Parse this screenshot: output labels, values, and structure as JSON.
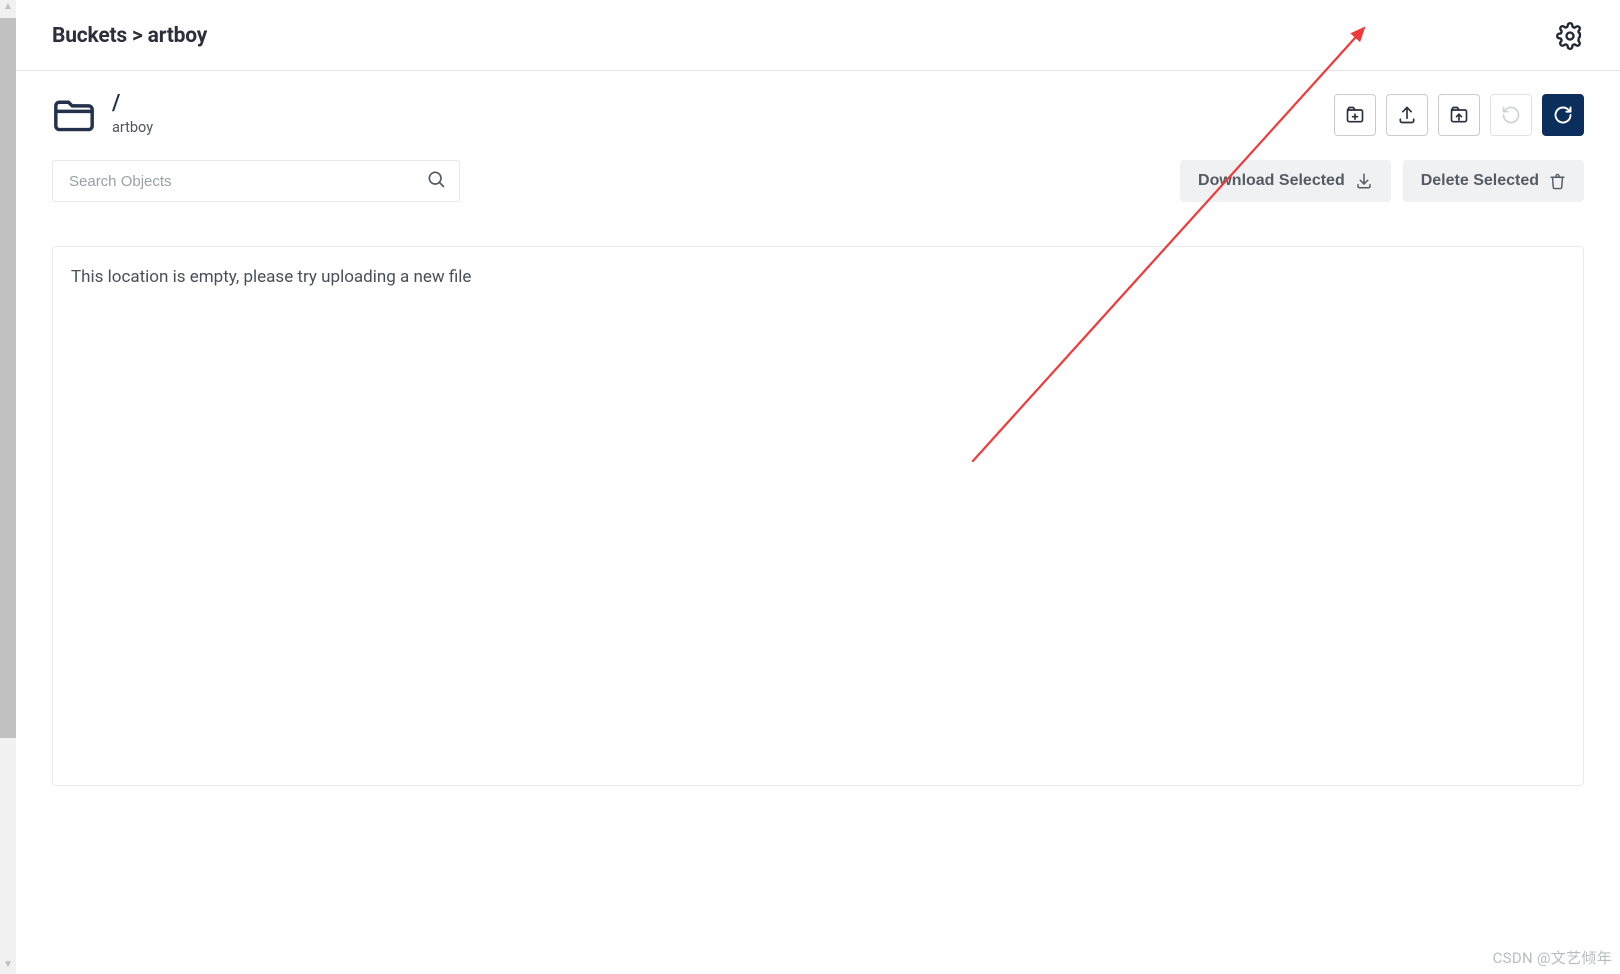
{
  "breadcrumb": {
    "root": "Buckets",
    "separator": ">",
    "current": "artboy"
  },
  "path": {
    "slash": "/",
    "bucket_name": "artboy"
  },
  "toolbar": {
    "create_folder_title": "Create Folder",
    "upload_title": "Upload",
    "upload_folder_title": "Upload Folder",
    "rewind_title": "Rewind",
    "refresh_title": "Refresh"
  },
  "search": {
    "placeholder": "Search Objects",
    "value": ""
  },
  "bulk": {
    "download_label": "Download Selected",
    "delete_label": "Delete Selected"
  },
  "listing": {
    "empty_message": "This location is empty, please try uploading a new file"
  },
  "watermark": "CSDN @文艺倾年"
}
